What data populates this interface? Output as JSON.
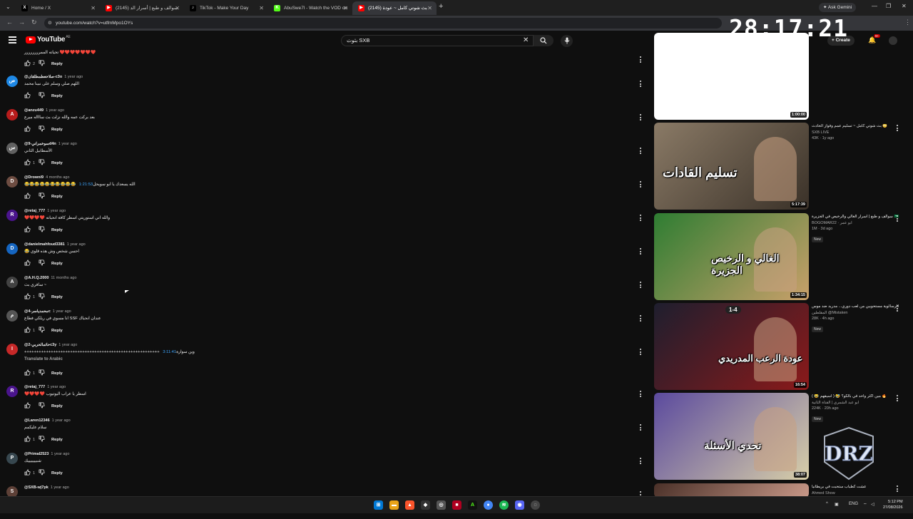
{
  "browser": {
    "tabs": [
      {
        "title": "Home / X",
        "icon": "x-logo-icon",
        "color": "#000000",
        "glyph": "X",
        "active": false
      },
      {
        "title": "سوالف و طبع | أسرار الد (2145)",
        "icon": "youtube-icon",
        "color": "#ff0000",
        "glyph": "▶",
        "active": false
      },
      {
        "title": "TikTok - Make Your Day",
        "icon": "tiktok-icon",
        "color": "#000000",
        "glyph": "♪",
        "active": false
      },
      {
        "title": "AbuSwe7l - Watch the VOD on",
        "icon": "kick-icon",
        "color": "#53fc18",
        "glyph": "K",
        "active": false
      },
      {
        "title": "(2145) بث شوتي كامل ~ عودة",
        "icon": "youtube-icon",
        "color": "#ff0000",
        "glyph": "▶",
        "active": true
      }
    ],
    "url": "youtube.com/watch?v=utfmMpo1OYs",
    "ask_gemini": "Ask Gemini"
  },
  "overlay_timer": "28:17:21",
  "header": {
    "logo_text": "YouTube",
    "country": "AE",
    "search_value": "بثوث SXB",
    "create_label": "Create",
    "notif_count": "9+"
  },
  "comments": [
    {
      "user": "",
      "time": "",
      "text": "تحياته الممرررررررر ❤️❤️❤️❤️❤️❤️❤️",
      "likes": "2",
      "avatar_char": "",
      "avatar_color": "#0f0f0f",
      "timestamp": ""
    },
    {
      "user": "@صلاحعطمطلقان-c3o",
      "time": "1 year ago",
      "text": "اللهم صلي وسلم على نبينا محمد",
      "likes": "",
      "avatar_char": "ص",
      "avatar_color": "#1e88e5",
      "timestamp": ""
    },
    {
      "user": "@anzu449",
      "time": "1 year ago",
      "text": "بعد بركت عمه والله نزلت بث ساااله ميرع",
      "likes": "",
      "avatar_char": "A",
      "avatar_color": "#b71c1c",
      "timestamp": ""
    },
    {
      "user": "@سوخمراني-9d4n",
      "time": "1 year ago",
      "text": "الأسطابيل الثاني",
      "likes": "1",
      "avatar_char": "س",
      "avatar_color": "#616161",
      "timestamp": ""
    },
    {
      "user": "@Drowni9",
      "time": "4 months ago",
      "text": "😂😂😂😂😂😂😂😂😂😂 الله يسعدك يا ابو سويحل",
      "likes": "",
      "avatar_char": "D",
      "avatar_color": "#6d4c41",
      "timestamp": "1:21:53"
    },
    {
      "user": "@retaj_777",
      "time": "1 year ago",
      "text": "❤️❤️❤️❤️ والله اني استوريتي اسطر كافة انحياته",
      "likes": "",
      "avatar_char": "R",
      "avatar_color": "#4a148c",
      "timestamp": ""
    },
    {
      "user": "@danielmahfoud3381",
      "time": "1 year ago",
      "text": "😂 احسن شخص وش هذه قلوي",
      "likes": "",
      "avatar_char": "D",
      "avatar_color": "#1565c0",
      "timestamp": ""
    },
    {
      "user": "@A.H.Q.2000",
      "time": "11 months ago",
      "text": "سافري بث ~",
      "likes": "1",
      "avatar_char": "A",
      "avatar_color": "#424242",
      "timestamp": ""
    },
    {
      "user": "@محمدياسر-4c",
      "time": "1 year ago",
      "text": "انا مسوي في ريلكي فطاع SSF عندان انحباك",
      "likes": "1",
      "avatar_char": "م",
      "avatar_color": "#555555",
      "timestamp": ""
    },
    {
      "user": "@حاتمالحربي-2c3y",
      "time": "1 year ago",
      "text": "++++++++++++++++++++++++++++++++++++++++++++++++++++++++ وين سوارة",
      "likes": "1",
      "avatar_char": "I",
      "avatar_color": "#c62828",
      "timestamp": "3:11:41",
      "translate": "Translate to Arabic"
    },
    {
      "user": "@retaj_777",
      "time": "1 year ago",
      "text": "❤️❤️❤️❤️ اسطر يا عراب اليوتيوب",
      "likes": "",
      "avatar_char": "R",
      "avatar_color": "#4a148c",
      "timestamp": ""
    },
    {
      "user": "@Laren12346",
      "time": "1 year ago",
      "text": "سلام عليكمم",
      "likes": "1",
      "avatar_char": "",
      "avatar_color": "#0f0f0f",
      "timestamp": ""
    },
    {
      "user": "@Primal2523",
      "time": "1 year ago",
      "text": "شبيييييييك",
      "likes": "1",
      "avatar_char": "P",
      "avatar_color": "#37474f",
      "timestamp": ""
    },
    {
      "user": "@SXB-wj7pk",
      "time": "1 year ago",
      "text": "",
      "likes": "",
      "avatar_char": "S",
      "avatar_color": "#5d4037",
      "timestamp": ""
    }
  ],
  "reply_label": "Reply",
  "sidebar": [
    {
      "duration": "1:00:00",
      "thumb_title": "",
      "bg1": "#ffffff",
      "bg2": "#ffffff",
      "title": "",
      "channel": "",
      "meta": "",
      "new": ""
    },
    {
      "duration": "5:17:39",
      "thumb_title": "تسليم القادات",
      "bg1": "#8a7a66",
      "bg2": "#3a3128",
      "title": "بث شوتي كامل ~ تسليم عمم وفواز الحادث 😳",
      "channel": "SXB LIVE",
      "meta": "43K · 1y ago",
      "new": ""
    },
    {
      "duration": "1:34:15",
      "thumb_title": "الغالي و الرخيص الجزيرة",
      "bg1": "#2e7d32",
      "bg2": "#c9a06a",
      "title": "سوالف و طبع | أسرار الغالي والرخيص في الجزيرة 🇸🇦",
      "channel": "BOGOMAR22 · ابو عمر",
      "meta": "1M · 3d ago",
      "new": "New"
    },
    {
      "duration": "16:54",
      "thumb_title": "عودة الرعب المدريدي",
      "bg1": "#1e1e2e",
      "bg2": "#8b1a1a",
      "title": "الرسالوية مستحوبين من لعب دوري... مدريد ضد موس",
      "channel": "المقلطين @Mistaken",
      "meta": "28K · 4h ago",
      "new": "New",
      "score": "1-4"
    },
    {
      "duration": "38:07",
      "thumb_title": "تحدي الأسئلة",
      "bg1": "#5b4a9e",
      "bg2": "#d8cfa8",
      "title": "مين اكثر واحد في بالكو؟ 🤣 ( اسيقهم 😂 ) 🔥",
      "channel": "ابو عبد الشمري | القناة الثانية",
      "meta": "224K · 20h ago",
      "new": "New"
    },
    {
      "duration": "",
      "thumb_title": "",
      "bg1": "#4a3028",
      "bg2": "#c89888",
      "title": "عشت كطباب ستحبت في بريطانيا",
      "channel": "Ahmed Show",
      "meta": "",
      "new": ""
    }
  ],
  "watermark_text": "DRZ",
  "taskbar": {
    "lang": "ENG",
    "time": "5:12 PM",
    "date": "27/08/2026"
  }
}
